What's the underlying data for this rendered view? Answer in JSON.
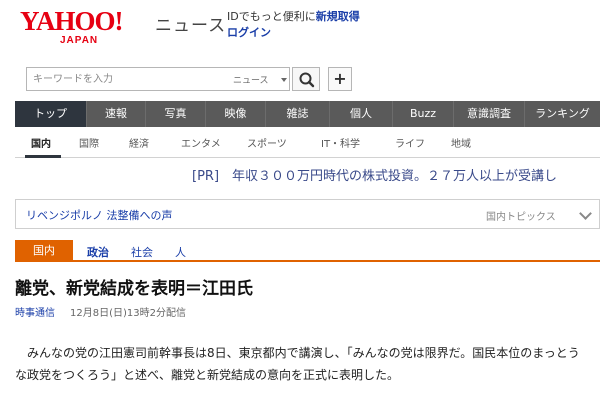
{
  "header": {
    "logo_main": "YAHOO!",
    "logo_sub": "JAPAN",
    "site_name": "ニュース",
    "promo_prefix": "IDでもっと便利に",
    "promo_link": "新規取得",
    "login": "ログイン"
  },
  "search": {
    "placeholder": "キーワードを入力",
    "scope": "ニュース",
    "search_icon": "search-icon",
    "add_label": "+"
  },
  "primary_nav": {
    "items": [
      "トップ",
      "速報",
      "写真",
      "映像",
      "雑誌",
      "個人",
      "Buzz",
      "意識調査",
      "ランキング"
    ],
    "active": "トップ"
  },
  "sub_nav": {
    "items": [
      "国内",
      "国際",
      "経済",
      "エンタメ",
      "スポーツ",
      "IT・科学",
      "ライフ",
      "地域"
    ],
    "active": "国内"
  },
  "pr": {
    "text": "[PR]　年収３００万円時代の株式投資。２７万人以上が受講し"
  },
  "topics": {
    "title": "リベンジポルノ 法整備への声",
    "label": "国内トピックス"
  },
  "category": {
    "badge": "国内",
    "links": [
      "政治",
      "社会",
      "人"
    ]
  },
  "article": {
    "title": "離党、新党結成を表明＝江田氏",
    "source": "時事通信",
    "date": "12月8日(日)13時2分配信",
    "body": "　みんなの党の江田憲司前幹事長は8日、東京都内で講演し、「みんなの党は限界だ。国民本位のまっとうな政党をつくろう」と述べ、離党と新党結成の意向を正式に表明した。"
  },
  "colors": {
    "brand_red": "#e60012",
    "link_blue": "#1a3ea8",
    "nav_gray": "#5a5a5a",
    "nav_active": "#2e353e",
    "category_orange": "#e06200"
  }
}
